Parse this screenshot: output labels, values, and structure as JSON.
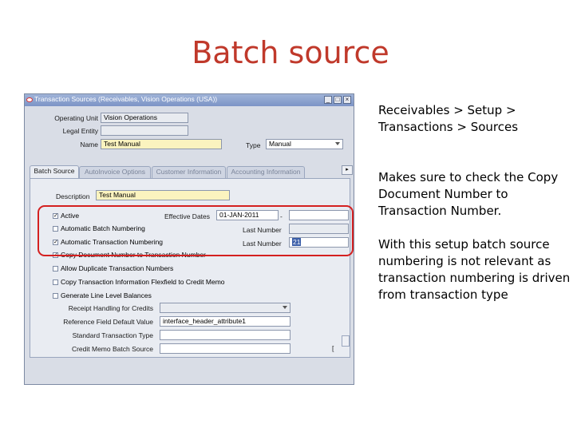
{
  "slide": {
    "title": "Batch source",
    "notes": [
      "Receivables > Setup > Transactions > Sources",
      "Makes sure to check the Copy Document Number to Transaction Number.",
      "With this setup batch source numbering is not relevant as transaction numbering is driven from transaction type"
    ]
  },
  "window": {
    "title": "Transaction Sources (Receivables, Vision Operations (USA))",
    "buttons": {
      "minimize": "_",
      "maximize": "□",
      "close": "×"
    }
  },
  "header": {
    "operating_unit_label": "Operating Unit",
    "operating_unit_value": "Vision Operations",
    "legal_entity_label": "Legal Entity",
    "legal_entity_value": "",
    "name_label": "Name",
    "name_value": "Test Manual",
    "type_label": "Type",
    "type_value": "Manual"
  },
  "tabs": [
    {
      "label": "Batch Source",
      "active": true
    },
    {
      "label": "AutoInvoice Options",
      "active": false
    },
    {
      "label": "Customer Information",
      "active": false
    },
    {
      "label": "Accounting Information",
      "active": false
    }
  ],
  "batch_source": {
    "description_label": "Description",
    "description_value": "Test Manual",
    "active_label": "Active",
    "active_checked": true,
    "effective_dates_label": "Effective Dates",
    "effective_from": "01-JAN-2011",
    "effective_separator": "-",
    "effective_to": "",
    "auto_batch_label": "Automatic Batch Numbering",
    "auto_batch_checked": false,
    "last_number_label_1": "Last Number",
    "last_number_value_1": "",
    "auto_trx_label": "Automatic Transaction Numbering",
    "auto_trx_checked": true,
    "last_number_label_2": "Last Number",
    "last_number_value_2": "21",
    "copy_doc_label": "Copy Document Number to Transaction Number",
    "copy_doc_checked": true,
    "allow_dup_label": "Allow Duplicate Transaction Numbers",
    "allow_dup_checked": false,
    "copy_flex_label": "Copy Transaction Information Flexfield to Credit Memo",
    "copy_flex_checked": false,
    "gen_line_label": "Generate Line Level Balances",
    "gen_line_checked": false,
    "receipt_handling_label": "Receipt Handling for Credits",
    "receipt_handling_value": "",
    "ref_field_label": "Reference Field Default Value",
    "ref_field_value": "interface_header_attribute1",
    "std_trx_type_label": "Standard Transaction Type",
    "std_trx_type_value": "",
    "cm_batch_label": "Credit Memo Batch Source",
    "cm_batch_value": "",
    "bracket_text": "["
  },
  "colors": {
    "title_red": "#c0392b",
    "highlight_red": "#d42020",
    "required_field": "#fbf3bf"
  }
}
